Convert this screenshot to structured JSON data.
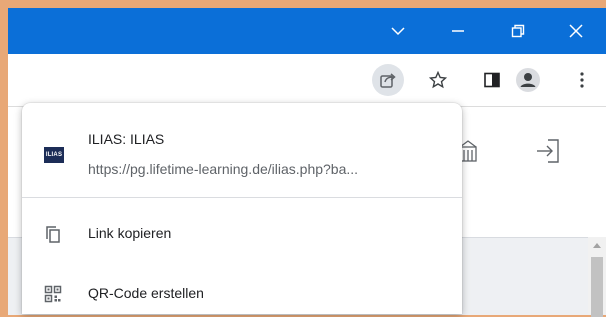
{
  "titlebar": {
    "buttons": [
      {
        "name": "chevron-down-icon",
        "glyph": "∨"
      },
      {
        "name": "minimize-icon",
        "glyph": "—"
      },
      {
        "name": "restore-icon",
        "glyph": "❐"
      },
      {
        "name": "close-icon",
        "glyph": "✕"
      }
    ]
  },
  "toolbar": {
    "icons": [
      "share-icon",
      "star-icon",
      "side-panel-icon",
      "profile-icon",
      "more-menu-icon"
    ]
  },
  "share_popup": {
    "favicon_text": "ILIAS",
    "page_title": "ILIAS: ILIAS",
    "page_url": "https://pg.lifetime-learning.de/ilias.php?ba...",
    "items": [
      {
        "label": "Link kopieren",
        "icon": "copy-icon"
      },
      {
        "label": "QR-Code erstellen",
        "icon": "qr-code-icon"
      }
    ]
  },
  "colors": {
    "titlebar": "#0b6fd8",
    "border": "#e8a877"
  }
}
